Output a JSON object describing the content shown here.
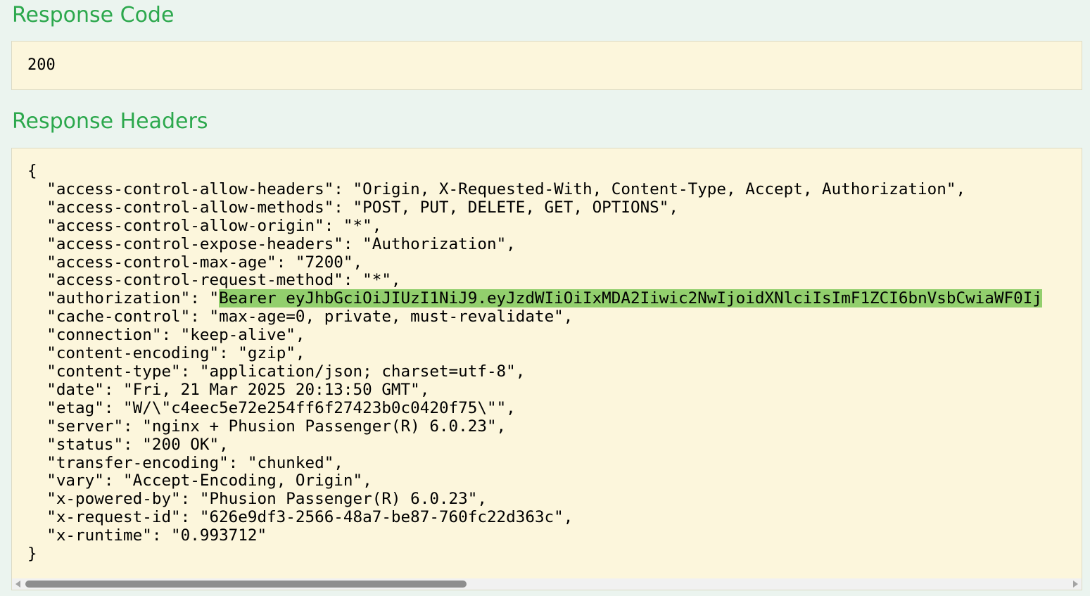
{
  "response_code": {
    "title": "Response Code",
    "value": "200"
  },
  "response_headers": {
    "title": "Response Headers",
    "open_brace": "{",
    "close_brace": "}",
    "lines": [
      {
        "key": "access-control-allow-headers",
        "value": "Origin, X-Requested-With, Content-Type, Accept, Authorization"
      },
      {
        "key": "access-control-allow-methods",
        "value": "POST, PUT, DELETE, GET, OPTIONS"
      },
      {
        "key": "access-control-allow-origin",
        "value": "*"
      },
      {
        "key": "access-control-expose-headers",
        "value": "Authorization"
      },
      {
        "key": "access-control-max-age",
        "value": "7200"
      },
      {
        "key": "access-control-request-method",
        "value": "*"
      },
      {
        "key": "authorization",
        "value": "Bearer eyJhbGciOiJIUzI1NiJ9.eyJzdWIiOiIxMDA2Iiwic2NwIjoidXNlciIsImF1ZCI6bnVsbCwiaWF0Ij",
        "highlighted": true
      },
      {
        "key": "cache-control",
        "value": "max-age=0, private, must-revalidate"
      },
      {
        "key": "connection",
        "value": "keep-alive"
      },
      {
        "key": "content-encoding",
        "value": "gzip"
      },
      {
        "key": "content-type",
        "value": "application/json; charset=utf-8"
      },
      {
        "key": "date",
        "value": "Fri, 21 Mar 2025 20:13:50 GMT"
      },
      {
        "key": "etag",
        "value": "W/\\\"c4eec5e72e254ff6f27423b0c0420f75\\\""
      },
      {
        "key": "server",
        "value": "nginx + Phusion Passenger(R) 6.0.23"
      },
      {
        "key": "status",
        "value": "200 OK"
      },
      {
        "key": "transfer-encoding",
        "value": "chunked"
      },
      {
        "key": "vary",
        "value": "Accept-Encoding, Origin"
      },
      {
        "key": "x-powered-by",
        "value": "Phusion Passenger(R) 6.0.23"
      },
      {
        "key": "x-request-id",
        "value": "626e9df3-2566-48a7-be87-760fc22d363c"
      },
      {
        "key": "x-runtime",
        "value": "0.993712"
      }
    ],
    "highlight_color": "#92cf6d"
  },
  "colors": {
    "page_background": "#ebf4ef",
    "title": "#2ca84d",
    "box_background": "#fcf6dc",
    "scroll_thumb": "#8e8e8e"
  },
  "icons": {
    "scroll_left": "scroll-left-arrow-icon",
    "scroll_right": "scroll-right-arrow-icon"
  }
}
